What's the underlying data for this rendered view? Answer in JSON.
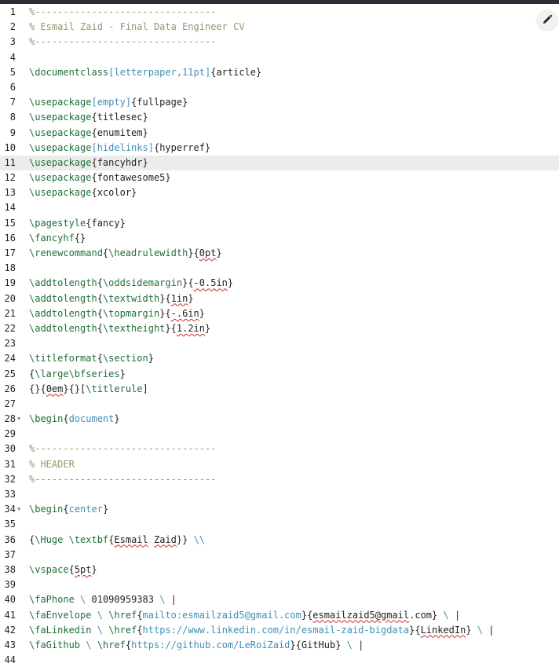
{
  "editor": {
    "active_line": 11,
    "lines": [
      {
        "n": "1",
        "fold": false,
        "tokens": [
          {
            "t": "%--------------------------------",
            "c": "comment"
          }
        ]
      },
      {
        "n": "2",
        "fold": false,
        "tokens": [
          {
            "t": "% Esmail Zaid - Final Data Engineer CV",
            "c": "comment"
          }
        ]
      },
      {
        "n": "3",
        "fold": false,
        "tokens": [
          {
            "t": "%--------------------------------",
            "c": "comment"
          }
        ]
      },
      {
        "n": "4",
        "fold": false,
        "tokens": []
      },
      {
        "n": "5",
        "fold": false,
        "tokens": [
          {
            "t": "\\documentclass",
            "c": "kw"
          },
          {
            "t": "[letterpaper,11pt]",
            "c": "opt"
          },
          {
            "t": "{article}",
            "c": "normal"
          }
        ]
      },
      {
        "n": "6",
        "fold": false,
        "tokens": []
      },
      {
        "n": "7",
        "fold": false,
        "tokens": [
          {
            "t": "\\usepackage",
            "c": "kw"
          },
          {
            "t": "[empty]",
            "c": "opt"
          },
          {
            "t": "{fullpage}",
            "c": "normal"
          }
        ]
      },
      {
        "n": "8",
        "fold": false,
        "tokens": [
          {
            "t": "\\usepackage",
            "c": "kw"
          },
          {
            "t": "{titlesec}",
            "c": "normal"
          }
        ]
      },
      {
        "n": "9",
        "fold": false,
        "tokens": [
          {
            "t": "\\usepackage",
            "c": "kw"
          },
          {
            "t": "{enumitem}",
            "c": "normal"
          }
        ]
      },
      {
        "n": "10",
        "fold": false,
        "tokens": [
          {
            "t": "\\usepackage",
            "c": "kw"
          },
          {
            "t": "[hidelinks]",
            "c": "opt"
          },
          {
            "t": "{hyperref}",
            "c": "normal"
          }
        ]
      },
      {
        "n": "11",
        "fold": false,
        "tokens": [
          {
            "t": "\\usepackage",
            "c": "kw"
          },
          {
            "t": "{fancyhdr}",
            "c": "normal"
          }
        ]
      },
      {
        "n": "12",
        "fold": false,
        "tokens": [
          {
            "t": "\\usepackage",
            "c": "kw"
          },
          {
            "t": "{fontawesome5}",
            "c": "normal"
          }
        ]
      },
      {
        "n": "13",
        "fold": false,
        "tokens": [
          {
            "t": "\\usepackage",
            "c": "kw"
          },
          {
            "t": "{xcolor}",
            "c": "normal"
          }
        ]
      },
      {
        "n": "14",
        "fold": false,
        "tokens": []
      },
      {
        "n": "15",
        "fold": false,
        "tokens": [
          {
            "t": "\\pagestyle",
            "c": "kw"
          },
          {
            "t": "{fancy}",
            "c": "normal"
          }
        ]
      },
      {
        "n": "16",
        "fold": false,
        "tokens": [
          {
            "t": "\\fancyhf",
            "c": "kw"
          },
          {
            "t": "{}",
            "c": "normal"
          }
        ]
      },
      {
        "n": "17",
        "fold": false,
        "tokens": [
          {
            "t": "\\renewcommand",
            "c": "kw"
          },
          {
            "t": "{",
            "c": "normal"
          },
          {
            "t": "\\headrulewidth",
            "c": "kw"
          },
          {
            "t": "}{",
            "c": "normal"
          },
          {
            "t": "0pt",
            "c": "normal",
            "sq": true
          },
          {
            "t": "}",
            "c": "normal"
          }
        ]
      },
      {
        "n": "18",
        "fold": false,
        "tokens": []
      },
      {
        "n": "19",
        "fold": false,
        "tokens": [
          {
            "t": "\\addtolength",
            "c": "kw"
          },
          {
            "t": "{",
            "c": "normal"
          },
          {
            "t": "\\oddsidemargin",
            "c": "kw"
          },
          {
            "t": "}{",
            "c": "normal"
          },
          {
            "t": "-0.5in",
            "c": "normal",
            "sq": true
          },
          {
            "t": "}",
            "c": "normal"
          }
        ]
      },
      {
        "n": "20",
        "fold": false,
        "tokens": [
          {
            "t": "\\addtolength",
            "c": "kw"
          },
          {
            "t": "{",
            "c": "normal"
          },
          {
            "t": "\\textwidth",
            "c": "kw"
          },
          {
            "t": "}{",
            "c": "normal"
          },
          {
            "t": "1in",
            "c": "normal",
            "sq": true
          },
          {
            "t": "}",
            "c": "normal"
          }
        ]
      },
      {
        "n": "21",
        "fold": false,
        "tokens": [
          {
            "t": "\\addtolength",
            "c": "kw"
          },
          {
            "t": "{",
            "c": "normal"
          },
          {
            "t": "\\topmargin",
            "c": "kw"
          },
          {
            "t": "}{",
            "c": "normal"
          },
          {
            "t": "-.6in",
            "c": "normal",
            "sq": true
          },
          {
            "t": "}",
            "c": "normal"
          }
        ]
      },
      {
        "n": "22",
        "fold": false,
        "tokens": [
          {
            "t": "\\addtolength",
            "c": "kw"
          },
          {
            "t": "{",
            "c": "normal"
          },
          {
            "t": "\\textheight",
            "c": "kw"
          },
          {
            "t": "}{",
            "c": "normal"
          },
          {
            "t": "1.2in",
            "c": "normal",
            "sq": true
          },
          {
            "t": "}",
            "c": "normal"
          }
        ]
      },
      {
        "n": "23",
        "fold": false,
        "tokens": []
      },
      {
        "n": "24",
        "fold": false,
        "tokens": [
          {
            "t": "\\titleformat",
            "c": "kw"
          },
          {
            "t": "{",
            "c": "normal"
          },
          {
            "t": "\\section",
            "c": "kw"
          },
          {
            "t": "}",
            "c": "normal"
          }
        ]
      },
      {
        "n": "25",
        "fold": false,
        "tokens": [
          {
            "t": "{",
            "c": "normal"
          },
          {
            "t": "\\large\\bfseries",
            "c": "kw"
          },
          {
            "t": "}",
            "c": "normal"
          }
        ]
      },
      {
        "n": "26",
        "fold": false,
        "tokens": [
          {
            "t": "{}{",
            "c": "normal"
          },
          {
            "t": "0em",
            "c": "normal",
            "sq": true
          },
          {
            "t": "}{}[",
            "c": "normal"
          },
          {
            "t": "\\titlerule",
            "c": "kw"
          },
          {
            "t": "]",
            "c": "normal"
          }
        ]
      },
      {
        "n": "27",
        "fold": false,
        "tokens": []
      },
      {
        "n": "28",
        "fold": true,
        "tokens": [
          {
            "t": "\\begin",
            "c": "kw"
          },
          {
            "t": "{",
            "c": "normal"
          },
          {
            "t": "document",
            "c": "opt"
          },
          {
            "t": "}",
            "c": "normal"
          }
        ]
      },
      {
        "n": "29",
        "fold": false,
        "tokens": []
      },
      {
        "n": "30",
        "fold": false,
        "tokens": [
          {
            "t": "%--------------------------------",
            "c": "comment"
          }
        ]
      },
      {
        "n": "31",
        "fold": false,
        "tokens": [
          {
            "t": "% HEADER",
            "c": "comment"
          }
        ]
      },
      {
        "n": "32",
        "fold": false,
        "tokens": [
          {
            "t": "%--------------------------------",
            "c": "comment"
          }
        ]
      },
      {
        "n": "33",
        "fold": false,
        "tokens": []
      },
      {
        "n": "34",
        "fold": true,
        "tokens": [
          {
            "t": "\\begin",
            "c": "kw"
          },
          {
            "t": "{",
            "c": "normal"
          },
          {
            "t": "center",
            "c": "opt"
          },
          {
            "t": "}",
            "c": "normal"
          }
        ]
      },
      {
        "n": "35",
        "fold": false,
        "tokens": []
      },
      {
        "n": "36",
        "fold": false,
        "tokens": [
          {
            "t": "{",
            "c": "normal"
          },
          {
            "t": "\\Huge \\textbf",
            "c": "kw"
          },
          {
            "t": "{",
            "c": "normal"
          },
          {
            "t": "Esmail",
            "c": "normal",
            "sq": true
          },
          {
            "t": " ",
            "c": "normal"
          },
          {
            "t": "Zaid",
            "c": "normal",
            "sq": true
          },
          {
            "t": "}} ",
            "c": "normal"
          },
          {
            "t": "\\\\",
            "c": "opt"
          }
        ]
      },
      {
        "n": "37",
        "fold": false,
        "tokens": []
      },
      {
        "n": "38",
        "fold": false,
        "tokens": [
          {
            "t": "\\vspace",
            "c": "kw"
          },
          {
            "t": "{",
            "c": "normal"
          },
          {
            "t": "5pt",
            "c": "normal",
            "sq": true
          },
          {
            "t": "}",
            "c": "normal"
          }
        ]
      },
      {
        "n": "39",
        "fold": false,
        "tokens": []
      },
      {
        "n": "40",
        "fold": false,
        "tokens": [
          {
            "t": "\\faPhone",
            "c": "kw"
          },
          {
            "t": " ",
            "c": "normal"
          },
          {
            "t": "\\",
            "c": "opt"
          },
          {
            "t": " 01090959383 ",
            "c": "normal"
          },
          {
            "t": "\\",
            "c": "opt"
          },
          {
            "t": " |",
            "c": "normal"
          }
        ]
      },
      {
        "n": "41",
        "fold": false,
        "tokens": [
          {
            "t": "\\faEnvelope",
            "c": "kw"
          },
          {
            "t": " ",
            "c": "normal"
          },
          {
            "t": "\\",
            "c": "opt"
          },
          {
            "t": " ",
            "c": "normal"
          },
          {
            "t": "\\href",
            "c": "kw"
          },
          {
            "t": "{",
            "c": "normal"
          },
          {
            "t": "mailto:esmailzaid5@gmail.com",
            "c": "opt"
          },
          {
            "t": "}{",
            "c": "normal"
          },
          {
            "t": "esmailzaid5@gmail",
            "c": "normal",
            "sq": true
          },
          {
            "t": ".com} ",
            "c": "normal"
          },
          {
            "t": "\\",
            "c": "opt"
          },
          {
            "t": " |",
            "c": "normal"
          }
        ]
      },
      {
        "n": "42",
        "fold": false,
        "tokens": [
          {
            "t": "\\faLinkedin",
            "c": "kw"
          },
          {
            "t": " ",
            "c": "normal"
          },
          {
            "t": "\\",
            "c": "opt"
          },
          {
            "t": " ",
            "c": "normal"
          },
          {
            "t": "\\href",
            "c": "kw"
          },
          {
            "t": "{",
            "c": "normal"
          },
          {
            "t": "https://www.linkedin.com/in/esmail-zaid-bigdata",
            "c": "opt"
          },
          {
            "t": "}{",
            "c": "normal"
          },
          {
            "t": "LinkedIn",
            "c": "normal",
            "sq": true
          },
          {
            "t": "} ",
            "c": "normal"
          },
          {
            "t": "\\",
            "c": "opt"
          },
          {
            "t": " |",
            "c": "normal"
          }
        ]
      },
      {
        "n": "43",
        "fold": false,
        "tokens": [
          {
            "t": "\\faGithub",
            "c": "kw"
          },
          {
            "t": " ",
            "c": "normal"
          },
          {
            "t": "\\",
            "c": "opt"
          },
          {
            "t": " ",
            "c": "normal"
          },
          {
            "t": "\\href",
            "c": "kw"
          },
          {
            "t": "{",
            "c": "normal"
          },
          {
            "t": "https://github.com/LeRoiZaid",
            "c": "opt"
          },
          {
            "t": "}{GitHub} ",
            "c": "normal"
          },
          {
            "t": "\\",
            "c": "opt"
          },
          {
            "t": " |",
            "c": "normal"
          }
        ]
      },
      {
        "n": "44",
        "fold": false,
        "tokens": []
      }
    ]
  },
  "toolbar": {
    "edit_icon": "pencil-icon"
  },
  "colors": {
    "comment": "#8e9b6a",
    "keyword": "#1f6f3a",
    "option": "#3f8fb5",
    "text": "#222222",
    "active_line_bg": "#ececec",
    "spell_error": "#cf2b2b"
  }
}
